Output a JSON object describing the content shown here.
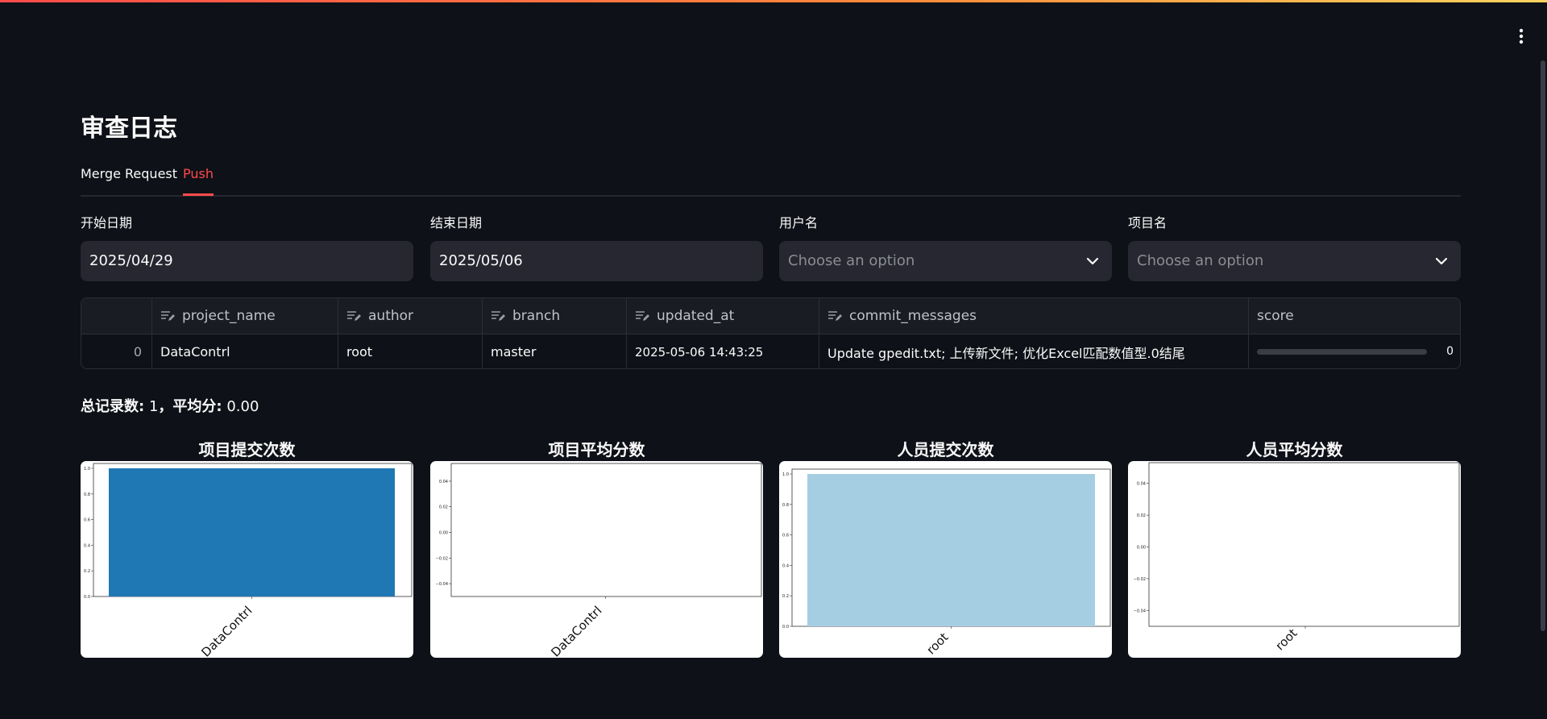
{
  "page": {
    "title": "审查日志"
  },
  "tabs": [
    {
      "label": "Merge Request",
      "active": false
    },
    {
      "label": "Push",
      "active": true
    }
  ],
  "filters": {
    "start_date": {
      "label": "开始日期",
      "value": "2025/04/29"
    },
    "end_date": {
      "label": "结束日期",
      "value": "2025/05/06"
    },
    "user": {
      "label": "用户名",
      "placeholder": "Choose an option"
    },
    "project": {
      "label": "项目名",
      "placeholder": "Choose an option"
    }
  },
  "table": {
    "columns": [
      "project_name",
      "author",
      "branch",
      "updated_at",
      "commit_messages",
      "score"
    ],
    "rows": [
      {
        "index": "0",
        "project_name": "DataContrl",
        "author": "root",
        "branch": "master",
        "updated_at": "2025-05-06 14:43:25",
        "commit_messages": "Update gpedit.txt; 上传新文件; 优化Excel匹配数值型.0结尾",
        "score": "0"
      }
    ]
  },
  "summary": {
    "total_label": "总记录数:",
    "total_value": "1",
    "sep": "，",
    "avg_label": "平均分:",
    "avg_value": "0.00"
  },
  "colors": {
    "accent": "#ff4b4b",
    "bar_blue": "#1f77b4",
    "bar_lightblue": "#a6cee3"
  },
  "chart_data": [
    {
      "type": "bar",
      "title": "项目提交次数",
      "categories": [
        "DataContrl"
      ],
      "values": [
        1
      ],
      "ylim": [
        0,
        1.0
      ],
      "yticks": [
        "0.0",
        "0.2",
        "0.4",
        "0.6",
        "0.8",
        "1.0"
      ],
      "color": "#1f77b4"
    },
    {
      "type": "bar",
      "title": "项目平均分数",
      "categories": [
        "DataContrl"
      ],
      "values": [
        0
      ],
      "ylim": [
        -0.05,
        0.05
      ],
      "yticks": [
        "−0.04",
        "−0.02",
        "0.00",
        "0.02",
        "0.04"
      ],
      "color": "#1f77b4"
    },
    {
      "type": "bar",
      "title": "人员提交次数",
      "categories": [
        "root"
      ],
      "values": [
        1
      ],
      "ylim": [
        0,
        1.0
      ],
      "yticks": [
        "0.0",
        "0.2",
        "0.4",
        "0.6",
        "0.8",
        "1.0"
      ],
      "color": "#a6cee3"
    },
    {
      "type": "bar",
      "title": "人员平均分数",
      "categories": [
        "root"
      ],
      "values": [
        0
      ],
      "ylim": [
        -0.05,
        0.05
      ],
      "yticks": [
        "−0.04",
        "−0.02",
        "0.00",
        "0.02",
        "0.04"
      ],
      "color": "#a6cee3"
    }
  ]
}
